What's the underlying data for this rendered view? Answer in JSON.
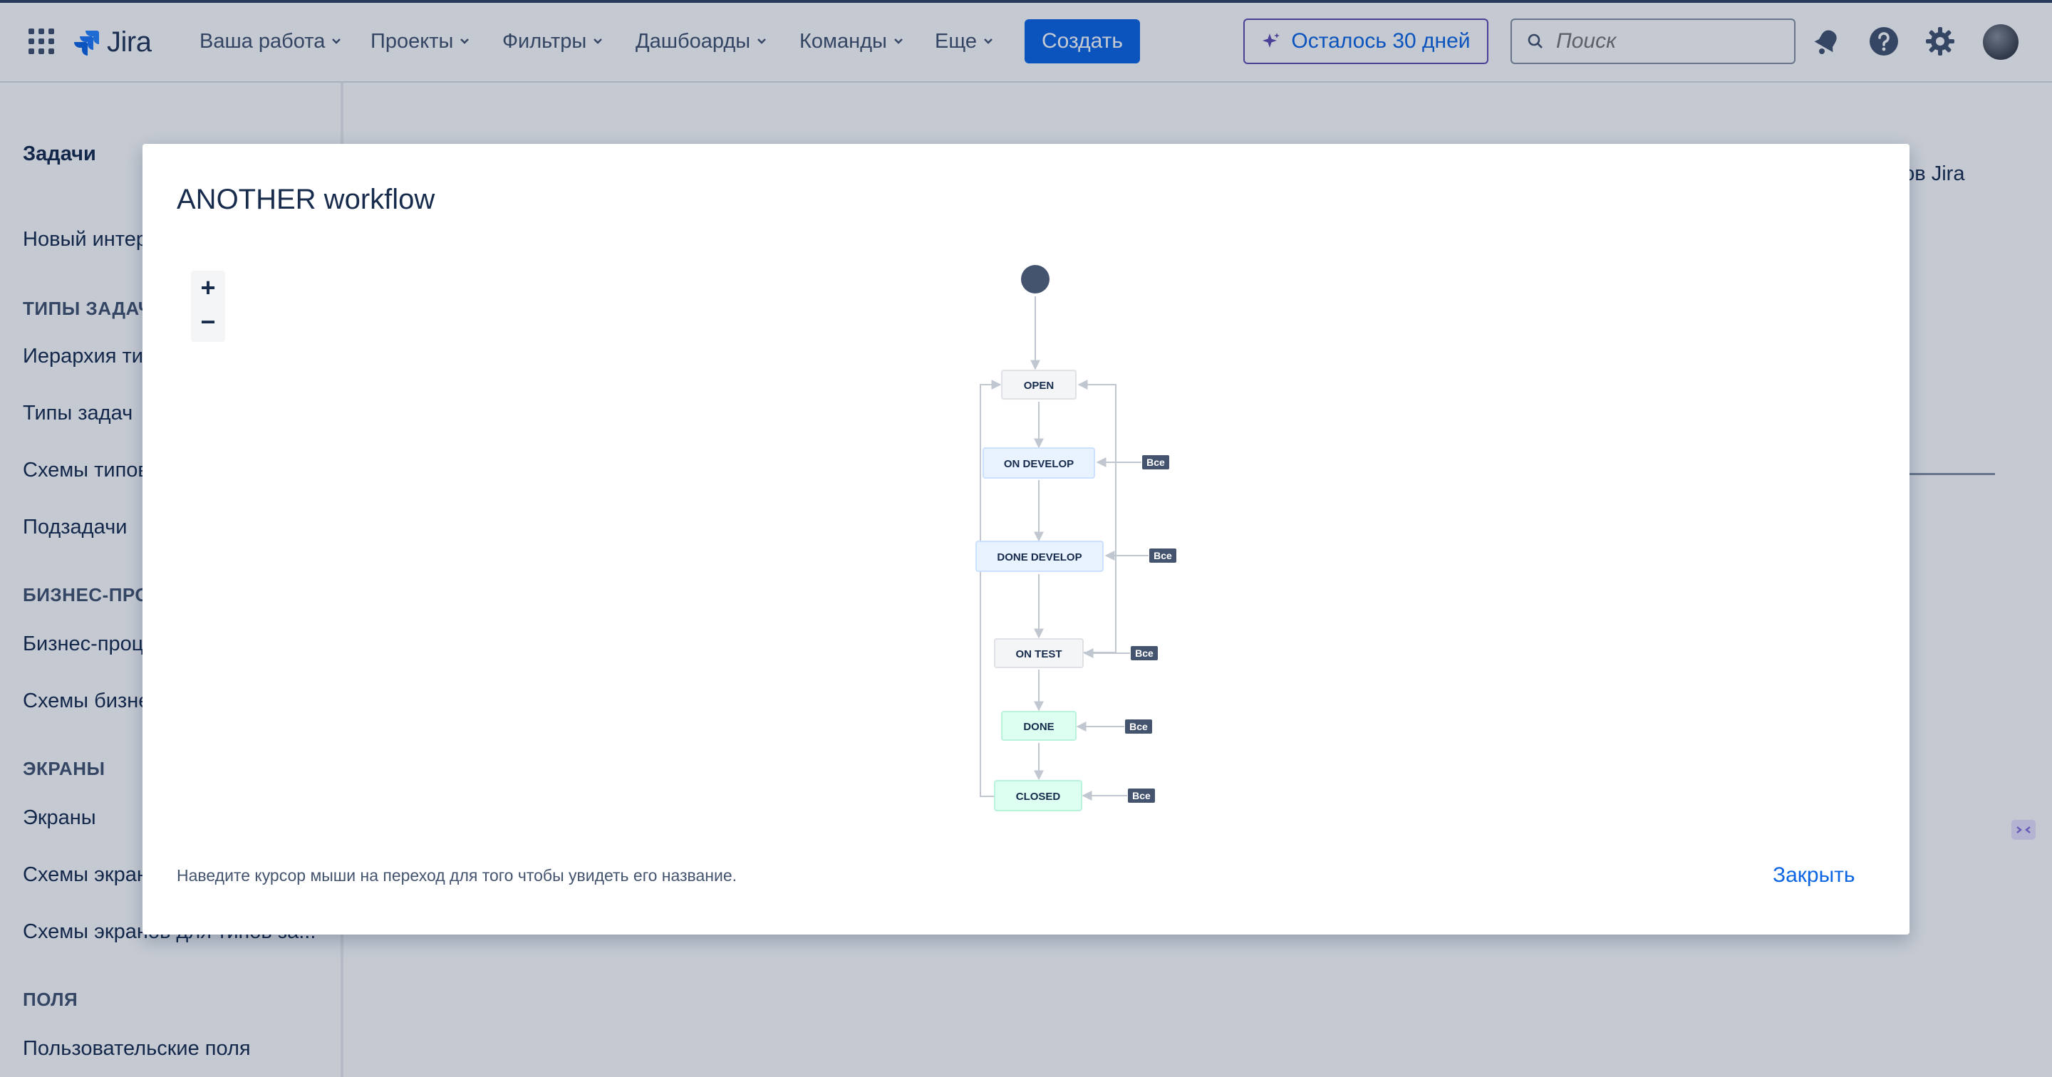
{
  "nav": {
    "logo": "Jira",
    "items": [
      "Ваша работа",
      "Проекты",
      "Фильтры",
      "Дашбоарды",
      "Команды",
      "Еще"
    ],
    "create_label": "Создать",
    "trial_label": "Осталось 30 дней",
    "search_placeholder": "Поиск"
  },
  "sidebar": {
    "title": "Задачи",
    "items": [
      {
        "kind": "item",
        "label": "Новый интер"
      },
      {
        "kind": "head",
        "label": "ТИПЫ ЗАДАЧ"
      },
      {
        "kind": "item",
        "label": "Иерархия ти"
      },
      {
        "kind": "item",
        "label": "Типы задач"
      },
      {
        "kind": "item",
        "label": "Схемы типов"
      },
      {
        "kind": "item",
        "label": "Подзадачи"
      },
      {
        "kind": "head",
        "label": "БИЗНЕС-ПРО"
      },
      {
        "kind": "item",
        "label": "Бизнес-проц"
      },
      {
        "kind": "item",
        "label": "Схемы бизне"
      },
      {
        "kind": "head",
        "label": "ЭКРАНЫ"
      },
      {
        "kind": "item",
        "label": "Экраны"
      },
      {
        "kind": "item",
        "label": "Схемы экран"
      },
      {
        "kind": "item",
        "label": "Схемы экранов для типов за..."
      },
      {
        "kind": "head",
        "label": "ПОЛЯ"
      },
      {
        "kind": "item",
        "label": "Пользовательские поля"
      }
    ]
  },
  "main": {
    "partial_text": "ров Jira"
  },
  "modal": {
    "title": "ANOTHER workflow",
    "zoom_in": "+",
    "zoom_out": "−",
    "hint": "Наведите курсор мыши на переход для того чтобы увидеть его название.",
    "close_label": "Закрыть"
  },
  "workflow": {
    "statuses": [
      {
        "name": "OPEN",
        "category": "todo",
        "all_transition": false
      },
      {
        "name": "ON DEVELOP",
        "category": "inprogress",
        "all_transition": true
      },
      {
        "name": "DONE DEVELOP",
        "category": "inprogress",
        "all_transition": true
      },
      {
        "name": "ON TEST",
        "category": "todo",
        "all_transition": true
      },
      {
        "name": "DONE",
        "category": "done",
        "all_transition": true
      },
      {
        "name": "CLOSED",
        "category": "done",
        "all_transition": true
      }
    ],
    "all_label": "Все",
    "colors": {
      "todo_bg": "#f4f5f7",
      "todo_border": "#dfe1e6",
      "inprogress_bg": "#e9f2ff",
      "inprogress_border": "#cce0ff",
      "done_bg": "#dcfff1",
      "done_border": "#baf3db",
      "start": "#44546f",
      "arrow": "#c1c7d0",
      "badge": "#44546f"
    }
  }
}
